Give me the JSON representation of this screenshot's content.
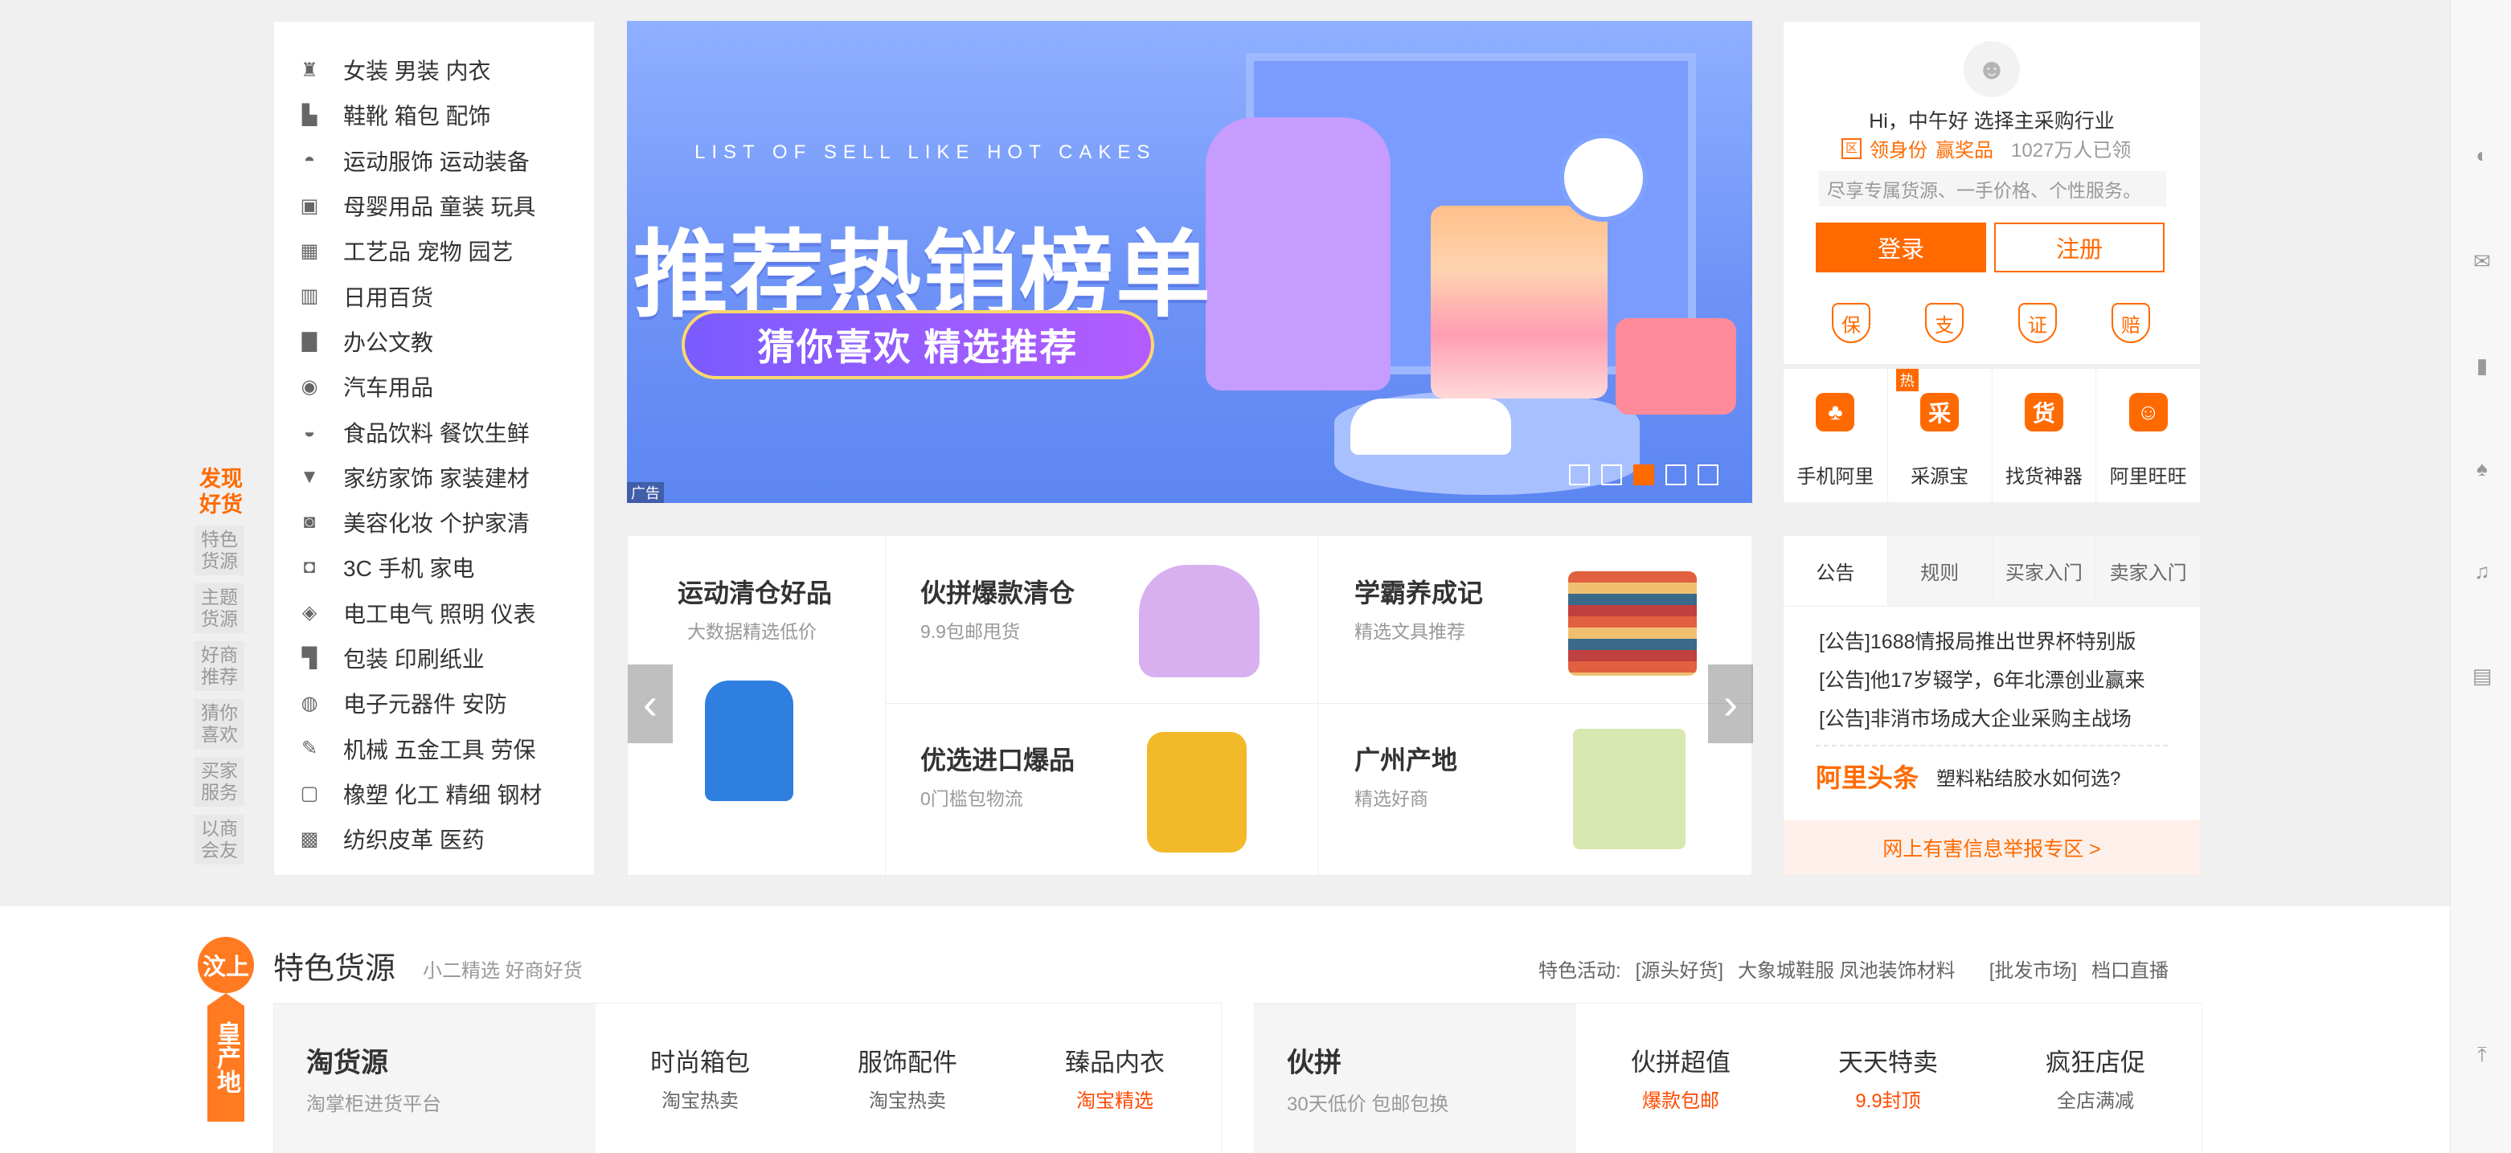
{
  "categories": [
    {
      "label": "女装 男装 内衣",
      "icon": "dress-icon"
    },
    {
      "label": "鞋靴 箱包 配饰",
      "icon": "boot-icon"
    },
    {
      "label": "运动服饰 运动装备",
      "icon": "sport-icon"
    },
    {
      "label": "母婴用品 童装 玩具",
      "icon": "baby-icon"
    },
    {
      "label": "工艺品 宠物 园艺",
      "icon": "craft-icon"
    },
    {
      "label": "日用百货",
      "icon": "cup-icon"
    },
    {
      "label": "办公文教",
      "icon": "file-icon"
    },
    {
      "label": "汽车用品",
      "icon": "wheel-icon"
    },
    {
      "label": "食品饮料 餐饮生鲜",
      "icon": "food-icon"
    },
    {
      "label": "家纺家饰 家装建材",
      "icon": "paint-icon"
    },
    {
      "label": "美容化妆 个护家清",
      "icon": "cosmetic-icon"
    },
    {
      "label": "3C 手机 家电",
      "icon": "camera-icon"
    },
    {
      "label": "电工电气 照明 仪表",
      "icon": "plug-icon"
    },
    {
      "label": "包装 印刷纸业",
      "icon": "box-icon"
    },
    {
      "label": "电子元器件 安防",
      "icon": "bulb-icon"
    },
    {
      "label": "机械 五金工具 劳保",
      "icon": "wrench-icon"
    },
    {
      "label": "橡塑 化工 精细 钢材",
      "icon": "chem-icon"
    },
    {
      "label": "纺织皮革 医药",
      "icon": "grid-icon"
    }
  ],
  "discover": {
    "title": "发现好货",
    "items": [
      "特色货源",
      "主题货源",
      "好商推荐",
      "猜你喜欢",
      "买家服务",
      "以商会友"
    ]
  },
  "banner": {
    "subtitle": "LIST OF SELL LIKE HOT CAKES",
    "title": "推荐热销榜单",
    "pill": "猜你喜欢 精选推荐",
    "ad": "广告",
    "active_dot": 3
  },
  "user": {
    "greeting": "Hi，中午好  选择主采购行业",
    "promo_tag": "区",
    "promo_a": "领身份",
    "promo_b": "赢奖品",
    "promo_count": "1027万人已领",
    "hint": "尽享专属货源、一手价格、个性服务。",
    "login": "登录",
    "register": "注册",
    "shields": [
      "保",
      "支",
      "证",
      "赔"
    ]
  },
  "apps": [
    {
      "label": "手机阿里",
      "glyph": "♣"
    },
    {
      "label": "采源宝",
      "glyph": "采",
      "hot": "热"
    },
    {
      "label": "找货神器",
      "glyph": "货"
    },
    {
      "label": "阿里旺旺",
      "glyph": "☺"
    }
  ],
  "promo_grid": [
    {
      "title": "运动清仓好品",
      "sub": "大数据精选低价"
    },
    {
      "title": "伙拼爆款清仓",
      "sub": "9.9包邮甩货"
    },
    {
      "title": "学霸养成记",
      "sub": "精选文具推荐"
    },
    {
      "title": "优选进口爆品",
      "sub": "0门槛包物流"
    },
    {
      "title": "广州产地",
      "sub": "精选好商"
    }
  ],
  "notice": {
    "tabs": [
      "公告",
      "规则",
      "买家入门",
      "卖家入门"
    ],
    "items": [
      "[公告]1688情报局推出世界杯特别版",
      "[公告]他17岁辍学，6年北漂创业赢来",
      "[公告]非消市场成大企业采购主战场"
    ],
    "brand": "阿里头条",
    "headline": "塑料粘结胶水如何选?",
    "report": "网上有害信息举报专区  >"
  },
  "section": {
    "badge": "汶上",
    "badge_tail": "皇产地",
    "title": "特色货源",
    "subtitle": "小二精选 好商好货",
    "activity_label": "特色活动:",
    "activity_a": "[源头好货]",
    "activity_b": "大象城鞋服 凤池装饰材料",
    "market_label": "[批发市场]",
    "market_b": "档口直播",
    "box1": {
      "title": "淘货源",
      "sub": "淘掌柜进货平台",
      "cols": [
        {
          "h": "时尚箱包",
          "s": "淘宝热卖",
          "red": false
        },
        {
          "h": "服饰配件",
          "s": "淘宝热卖",
          "red": false
        },
        {
          "h": "臻品内衣",
          "s": "淘宝精选",
          "red": true
        }
      ]
    },
    "box2": {
      "title": "伙拼",
      "sub": "30天低价 包邮包换",
      "cols": [
        {
          "h": "伙拼超值",
          "s": "爆款包邮",
          "red": true
        },
        {
          "h": "天天特卖",
          "s": "9.9封顶",
          "red": true
        },
        {
          "h": "疯狂店促",
          "s": "全店满减",
          "red": false
        }
      ]
    }
  },
  "colors": {
    "accent": "#ff6a00"
  }
}
